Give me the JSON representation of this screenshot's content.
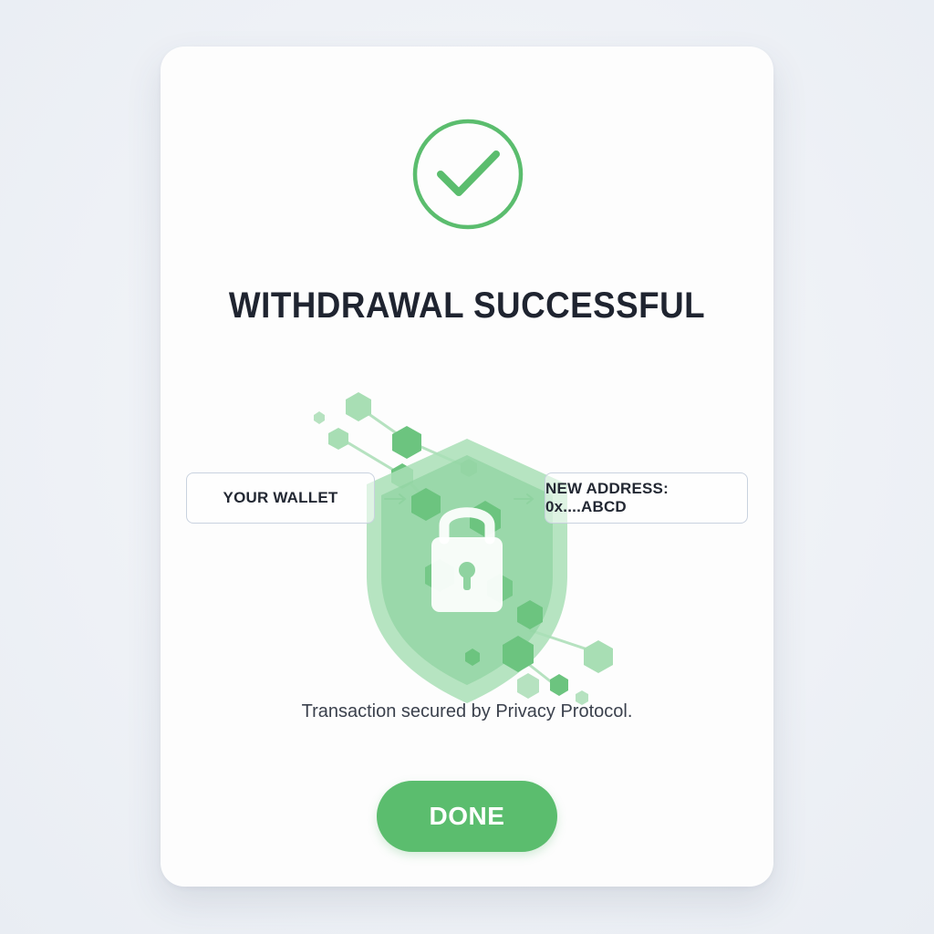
{
  "dialog": {
    "title": "WITHDRAWAL SUCCESSFUL",
    "caption": "Transaction secured by Privacy Protocol.",
    "done_label": "DONE"
  },
  "flow": {
    "from_label": "YOUR WALLET",
    "to_label": "NEW ADDRESS: 0x....ABCD"
  },
  "icons": {
    "status": "checkmark-circle-icon",
    "security": "shield-lock-icon",
    "arrows": "arrow-right-icon"
  },
  "colors": {
    "accent": "#5bbd6e",
    "shield": "#a9dfb6",
    "hexagon_dark": "#6cc47f",
    "hexagon_light": "#a8deb4",
    "text_dark": "#1f2430",
    "box_border": "#c9d2df"
  }
}
